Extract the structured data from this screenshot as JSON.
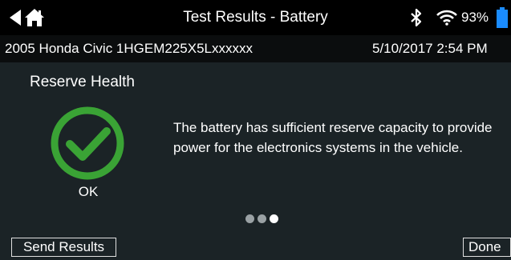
{
  "header": {
    "title": "Test Results - Battery",
    "battery_percent": "93%"
  },
  "vehicle": {
    "description": "2005 Honda Civic 1HGEM225X5Lxxxxxx",
    "datetime": "5/10/2017  2:54 PM"
  },
  "result": {
    "section_title": "Reserve Health",
    "status": "OK",
    "message": "The battery has sufficient reserve capacity to provide power for the electronics systems in the vehicle."
  },
  "pager": {
    "pages": 3,
    "active_index": 2
  },
  "footer": {
    "send_label": "Send Results",
    "done_label": "Done"
  },
  "colors": {
    "ok_green": "#3aa335",
    "battery_blue": "#1a8cff",
    "background": "#1b2326"
  },
  "icons": [
    "back-arrow-icon",
    "home-icon",
    "bluetooth-icon",
    "wifi-icon",
    "battery-icon",
    "checkmark-icon"
  ]
}
